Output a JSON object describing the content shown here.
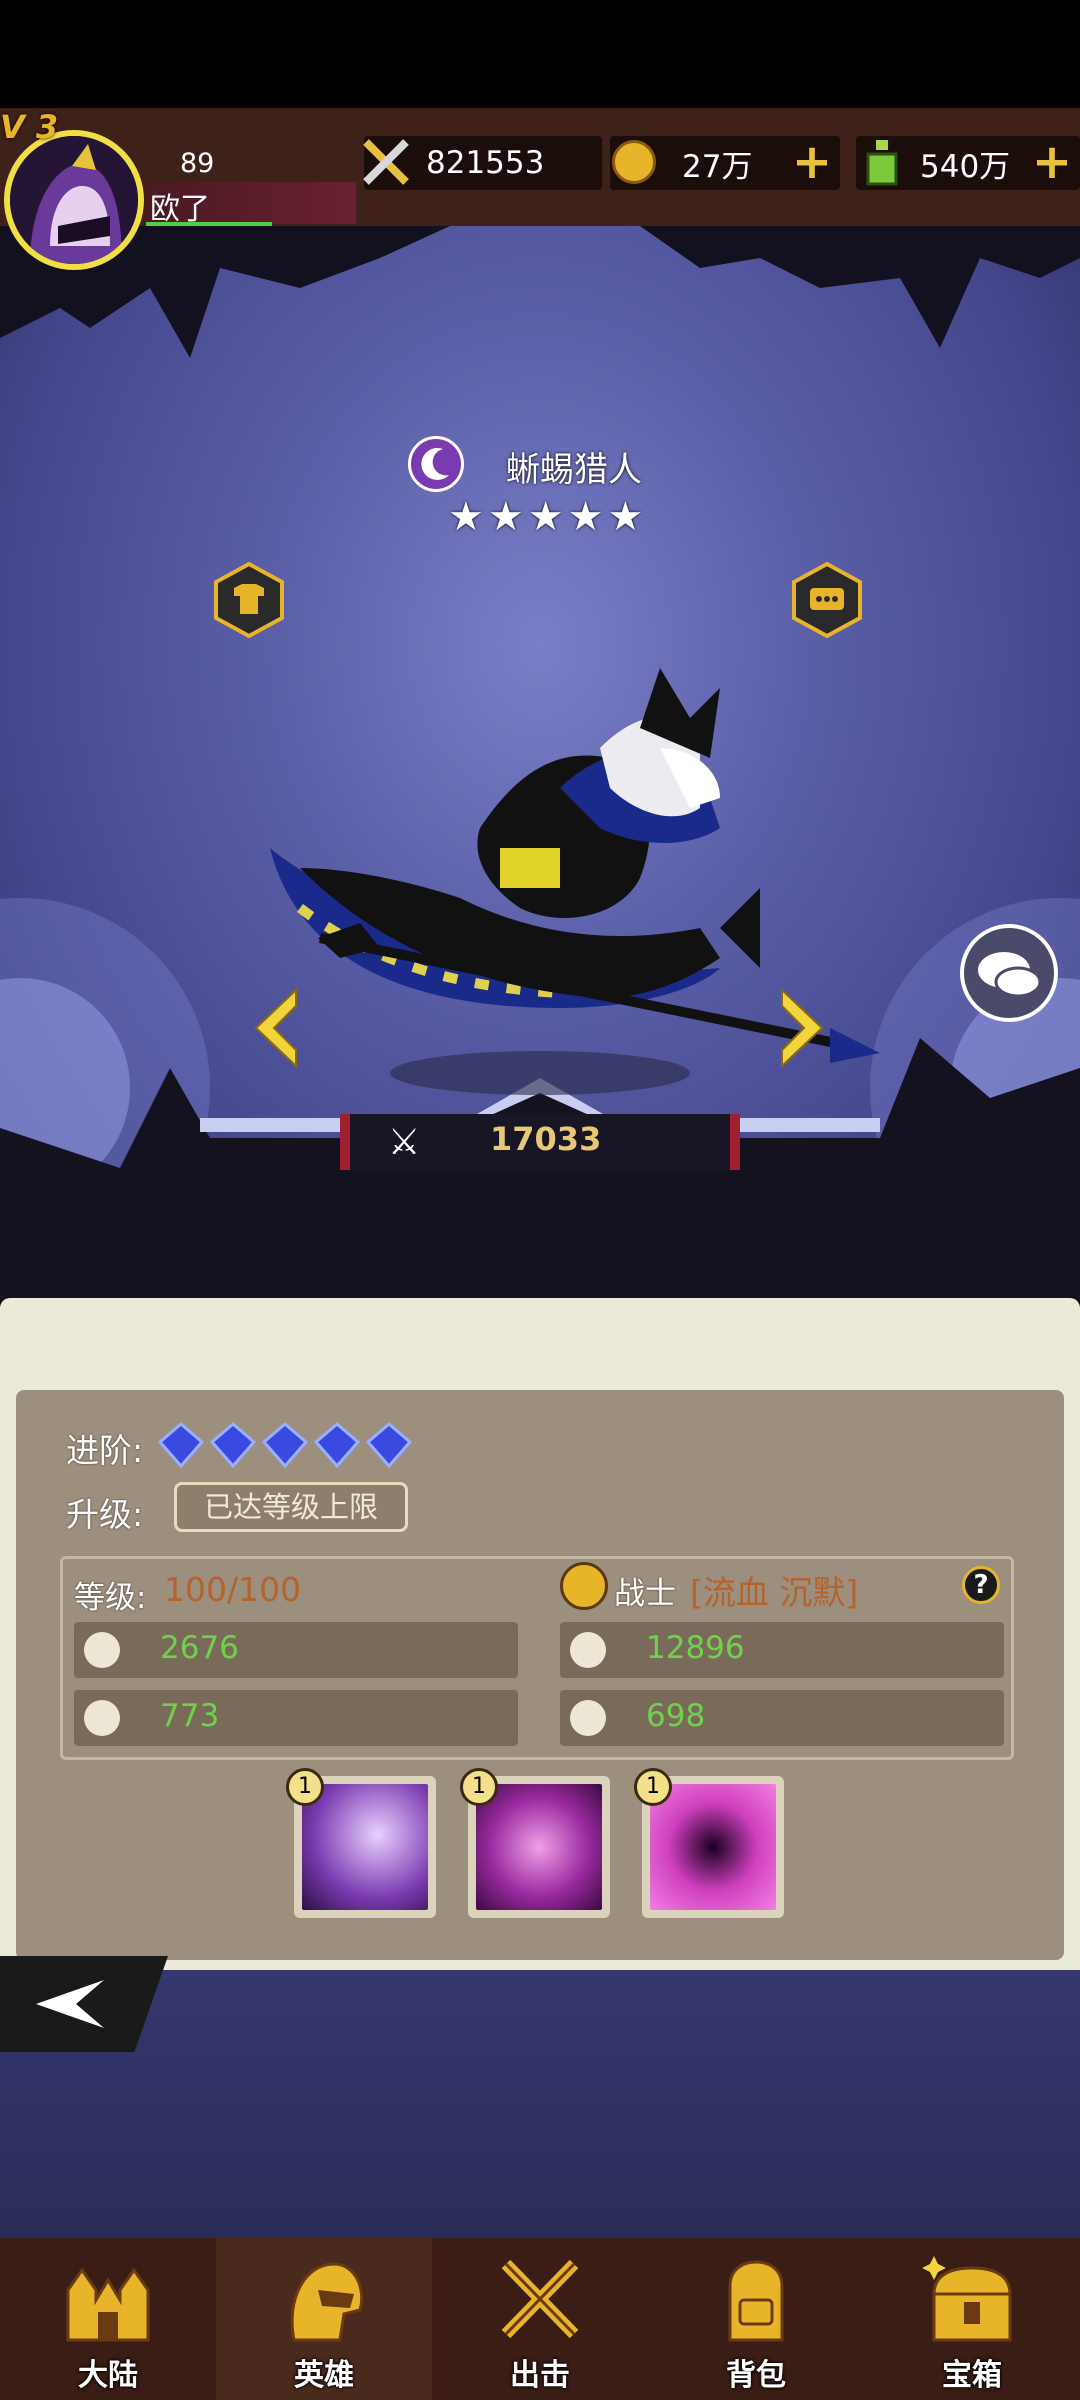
{
  "header": {
    "vip_label": "V 3",
    "player_level": "89",
    "player_name": "欧了",
    "combat_power": "821553",
    "gold": "27万",
    "potion": "540万"
  },
  "hero": {
    "name": "蜥蜴猎人",
    "stars": 5,
    "power": "17033"
  },
  "details": {
    "advance_label": "进阶:",
    "advance_gems": 5,
    "upgrade_label": "升级:",
    "upgrade_button": "已达等级上限",
    "level_label": "等级:",
    "level_value": "100/100",
    "class_name": "战士",
    "class_traits": "[流血 沉默]",
    "attack": "2676",
    "health": "12896",
    "defense": "773",
    "speed": "698"
  },
  "skills": [
    {
      "level": "1"
    },
    {
      "level": "1"
    },
    {
      "level": "1"
    }
  ],
  "nav": [
    {
      "label": "大陆",
      "icon": "castle-icon"
    },
    {
      "label": "英雄",
      "icon": "helmet-icon"
    },
    {
      "label": "出击",
      "icon": "crossed-swords-icon"
    },
    {
      "label": "背包",
      "icon": "backpack-icon"
    },
    {
      "label": "宝箱",
      "icon": "treasure-chest-icon"
    }
  ],
  "colors": {
    "accent_gold": "#e8c23c",
    "stat_green": "#6ed34a",
    "level_orange": "#b4622e",
    "panel_bg": "#9d8f7d"
  }
}
